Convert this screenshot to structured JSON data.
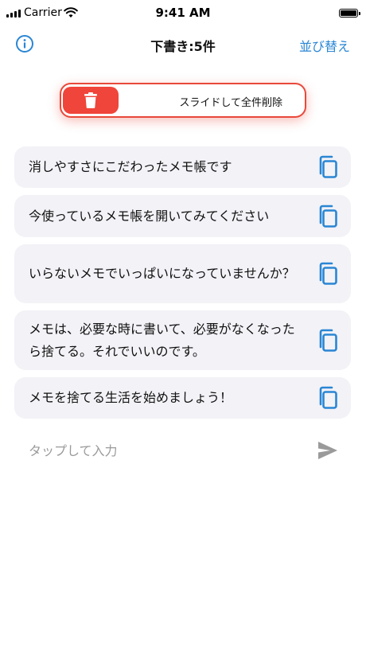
{
  "status_bar": {
    "carrier": "Carrier",
    "time": "9:41 AM",
    "icons": [
      "signal-icon",
      "wifi-icon",
      "battery-icon"
    ]
  },
  "nav": {
    "title": "下書き:5件",
    "sort_label": "並び替え",
    "info_icon": "info-icon"
  },
  "delete_slider": {
    "label": "スライドして全件削除",
    "icon": "trash-icon",
    "color": "#f0453a"
  },
  "memos": [
    {
      "text": "消しやすさにこだわったメモ帳です"
    },
    {
      "text": "今使っているメモ帳を開いてみてください"
    },
    {
      "text": "いらないメモでいっぱいになっていませんか？"
    },
    {
      "text": "メモは、必要な時に書いて、必要がなくなったら捨てる。それでいいのです。"
    },
    {
      "text": "メモを捨てる生活を始めましょう！"
    }
  ],
  "input": {
    "placeholder": "タップして入力",
    "value": "",
    "send_icon": "send-icon"
  },
  "colors": {
    "accent": "#2a86d4",
    "danger": "#f0453a",
    "card": "#f2f2f7"
  }
}
